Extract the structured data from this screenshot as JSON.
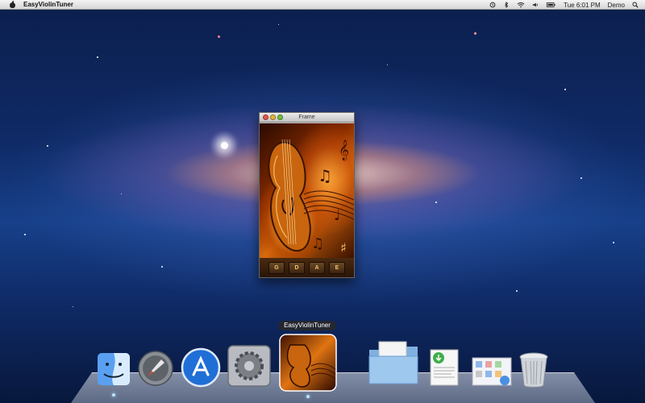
{
  "menubar": {
    "app_name": "EasyViolinTuner",
    "clock": "Tue 6:01 PM",
    "user": "Demo",
    "status_icons": [
      "time-machine-icon",
      "bluetooth-icon",
      "wifi-icon",
      "volume-icon",
      "battery-icon"
    ]
  },
  "window": {
    "title": "Frame",
    "strings": [
      "G",
      "D",
      "A",
      "E"
    ]
  },
  "dock": {
    "tooltip": "EasyViolinTuner",
    "items": [
      {
        "name": "Finder",
        "icon": "finder-icon"
      },
      {
        "name": "Launchpad",
        "icon": "rocket-icon"
      },
      {
        "name": "App Store",
        "icon": "app-store-icon"
      },
      {
        "name": "System Preferences",
        "icon": "gear-icon"
      },
      {
        "name": "EasyViolinTuner",
        "icon": "violin-icon"
      },
      {
        "name": "Documents",
        "icon": "folder-icon"
      },
      {
        "name": "Downloads",
        "icon": "document-icon"
      },
      {
        "name": "Applications",
        "icon": "stack-icon"
      },
      {
        "name": "Trash",
        "icon": "trash-icon"
      }
    ]
  }
}
